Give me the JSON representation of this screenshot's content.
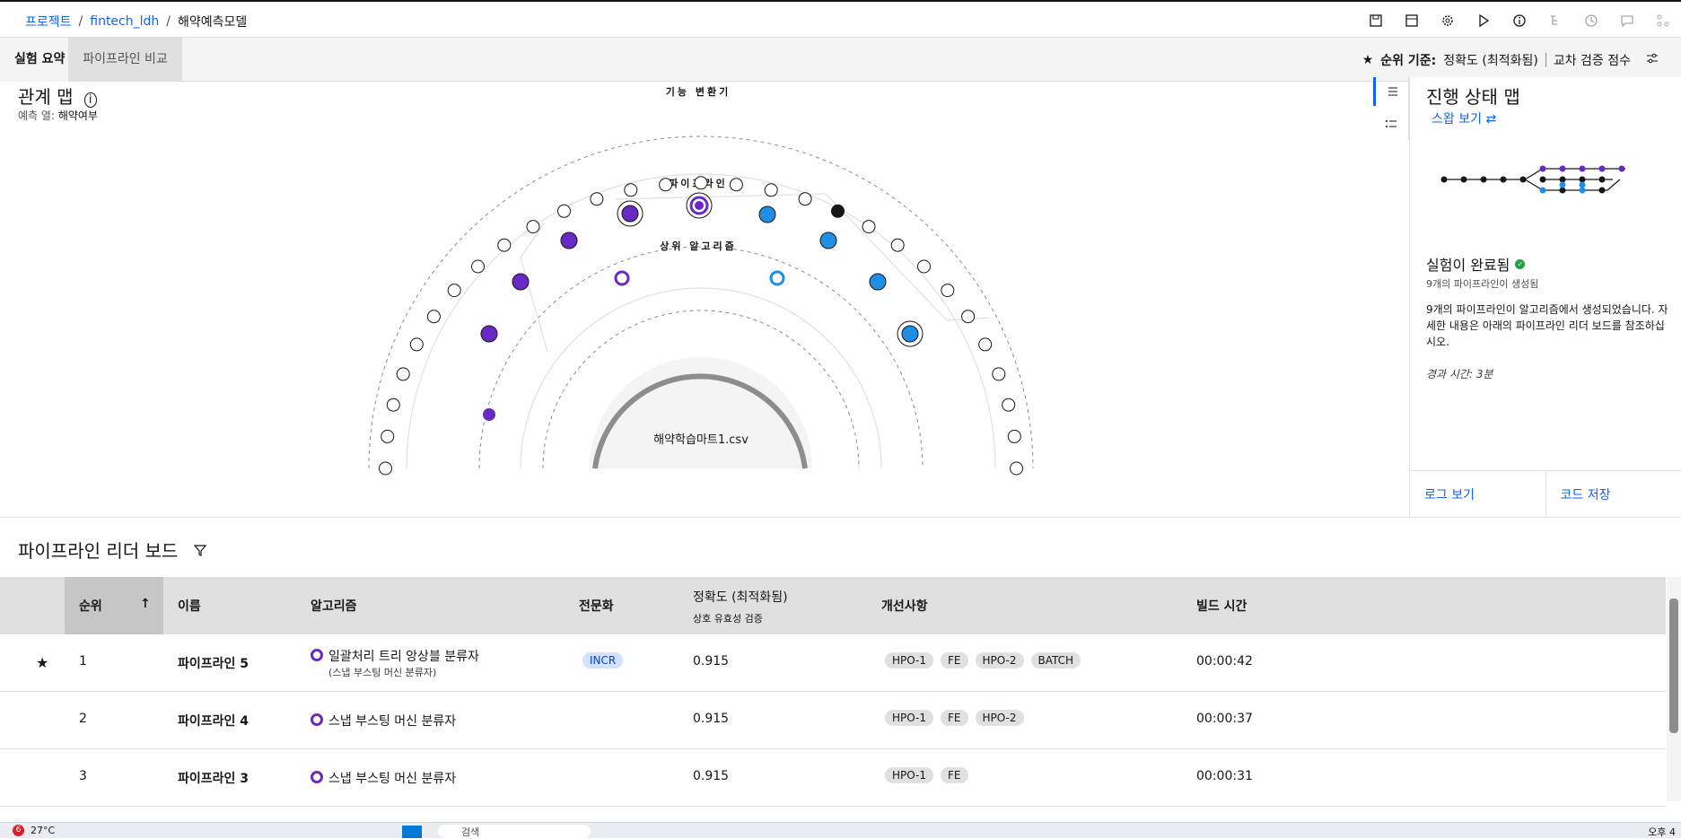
{
  "breadcrumb": {
    "items": [
      "프로젝트",
      "fintech_ldh",
      "해약예측모델"
    ]
  },
  "toolbar": {
    "icons": [
      "save-icon",
      "calculator-icon",
      "gear-icon",
      "play-icon",
      "info-icon",
      "tree-icon",
      "history-icon",
      "comment-icon",
      "share-icon"
    ]
  },
  "tabs": {
    "summary": "실험 요약",
    "compare": "파이프라인 비교"
  },
  "rank_criteria": {
    "label": "순위 기준:",
    "value": "정확도 (최적화됨)",
    "alt": "교차 검증 점수"
  },
  "relation_map": {
    "title": "관계 맵",
    "predict_label": "예측 열:",
    "predict_value": "해약여부",
    "ring_feature": "기능 변환기",
    "ring_pipeline": "파이프라인",
    "ring_algorithm": "상위 알고리즘",
    "dataset": "해약학습마트1.csv"
  },
  "progress_map": {
    "title": "진행 상태 맵",
    "swap": "스왑 보기",
    "status": "실험이 완료됨",
    "count": "9개의 파이프라인이 생성됨",
    "desc": "9개의 파이프라인이 알고리즘에서 생성되었습니다. 자세한 내용은 아래의 파이프라인 리더 보드를 참조하십시오.",
    "elapsed": "경과 시간: 3분",
    "log": "로그 보기",
    "save_code": "코드 저장"
  },
  "leaderboard": {
    "title": "파이프라인 리더 보드",
    "columns": {
      "rank": "순위",
      "name": "이름",
      "algorithm": "알고리즘",
      "specialization": "전문화",
      "accuracy": "정확도 (최적화됨)",
      "cv": "상호 유효성 검증",
      "enhancements": "개선사항",
      "build_time": "빌드 시간"
    },
    "rows": [
      {
        "rank": "1",
        "name": "파이프라인 5",
        "algo": "일괄처리 트리 앙상블 분류자",
        "algo_sub": "(스냅 부스팅 머신 분류자)",
        "spec": "INCR",
        "acc": "0.915",
        "tags": [
          "HPO-1",
          "FE",
          "HPO-2",
          "BATCH"
        ],
        "time": "00:00:42"
      },
      {
        "rank": "2",
        "name": "파이프라인 4",
        "algo": "스냅 부스팅 머신 분류자",
        "algo_sub": "",
        "spec": "",
        "acc": "0.915",
        "tags": [
          "HPO-1",
          "FE",
          "HPO-2"
        ],
        "time": "00:00:37"
      },
      {
        "rank": "3",
        "name": "파이프라인 3",
        "algo": "스냅 부스팅 머신 분류자",
        "algo_sub": "",
        "spec": "",
        "acc": "0.915",
        "tags": [
          "HPO-1",
          "FE"
        ],
        "time": "00:00:31"
      }
    ]
  },
  "taskbar": {
    "weather": "27°C",
    "badge": "6",
    "search": "검색",
    "time": "오후 4"
  },
  "colors": {
    "accent": "#0f62fe",
    "purple": "#6929c4",
    "blue": "#1f8fe5",
    "success": "#24a148"
  }
}
